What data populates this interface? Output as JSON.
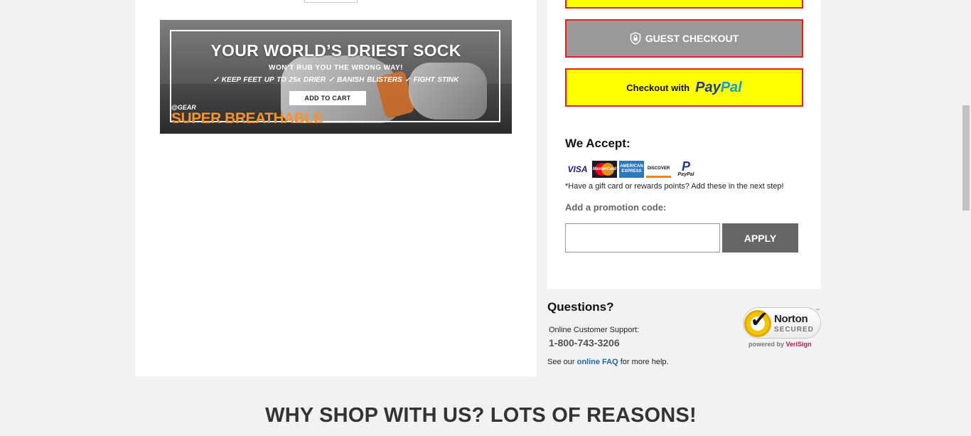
{
  "banner": {
    "headline": "YOUR WORLD’S DRIEST SOCK",
    "subheadline": "WON’T RUB YOU THE WRONG WAY!",
    "benefits": "✓ KEEP FEET UP TO 25x DRIER  ✓ BANISH BLISTERS  ✓ FIGHT STINK",
    "cta": "ADD TO CART",
    "brand": "@GEAR",
    "brand_title": "SUPER BREATHABLE"
  },
  "checkout": {
    "guest_label": "GUEST CHECKOUT",
    "paypal_prefix": "Checkout with",
    "paypal_brand_1": "Pay",
    "paypal_brand_2": "Pal"
  },
  "payment": {
    "title": "We Accept:",
    "cards": {
      "visa": "VISA",
      "mastercard": "MasterCard",
      "amex": "AMERICAN EXPRESS",
      "discover": "DISCOVER",
      "paypal": "PayPal"
    },
    "note": "*Have a gift card or rewards points? Add these in the next step!"
  },
  "promo": {
    "label": "Add a promotion code:",
    "placeholder": "",
    "button": "APPLY"
  },
  "support": {
    "title": "Questions?",
    "label": "Online Customer Support:",
    "phone": "1-800-743-3206",
    "faq_prefix": "See our",
    "faq_link": "online FAQ",
    "faq_suffix": "for more help."
  },
  "norton": {
    "name": "Norton",
    "secured": "SECURED",
    "tm": "™",
    "powered": "powered by",
    "verisign": "VeriSign"
  },
  "why_title": "WHY SHOP WITH US? LOTS OF REASONS!",
  "colors": {
    "checkout_yellow": "#ffff00",
    "checkout_border": "#e02020",
    "guest_gray": "#999999",
    "apply_gray": "#666666",
    "link_blue": "#1a6aa8"
  }
}
